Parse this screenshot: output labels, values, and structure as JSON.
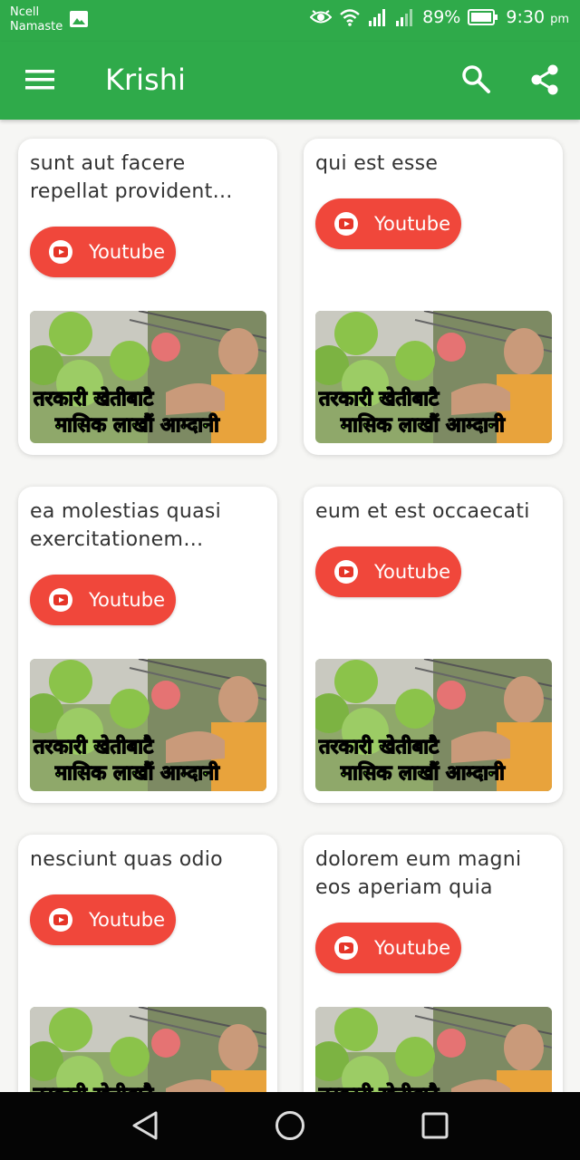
{
  "status_bar": {
    "carrier_line1": "Ncell",
    "carrier_line2": "Namaste",
    "battery": "89%",
    "time": "9:30",
    "ampm": "pm",
    "icons": [
      "gallery-icon",
      "eye-icon",
      "wifi-icon",
      "signal-icon",
      "signal-icon",
      "battery-icon"
    ]
  },
  "app_bar": {
    "title": "Krishi",
    "color": "#2faa4a",
    "icons": [
      "menu-icon",
      "search-icon",
      "share-icon"
    ]
  },
  "youtube_button": {
    "color": "#f0473b",
    "icon": "youtube-icon"
  },
  "thumbnail": {
    "line1": "तरकारी खेतीबाटै",
    "line2": "मासिक लाखौं आम्दानी"
  },
  "cards": [
    {
      "title": "sunt aut facere repellat provident occaecati",
      "button_label": "Youtube"
    },
    {
      "title": "qui est esse",
      "button_label": "Youtube"
    },
    {
      "title": "ea molestias quasi exercitationem repellat",
      "button_label": "Youtube"
    },
    {
      "title": "eum et est occaecati",
      "button_label": "Youtube"
    },
    {
      "title": "nesciunt quas odio",
      "button_label": "Youtube"
    },
    {
      "title": "dolorem eum magni eos aperiam quia",
      "button_label": "Youtube"
    }
  ],
  "nav_bar": {
    "icons": [
      "back-icon",
      "home-icon",
      "recents-icon"
    ]
  }
}
